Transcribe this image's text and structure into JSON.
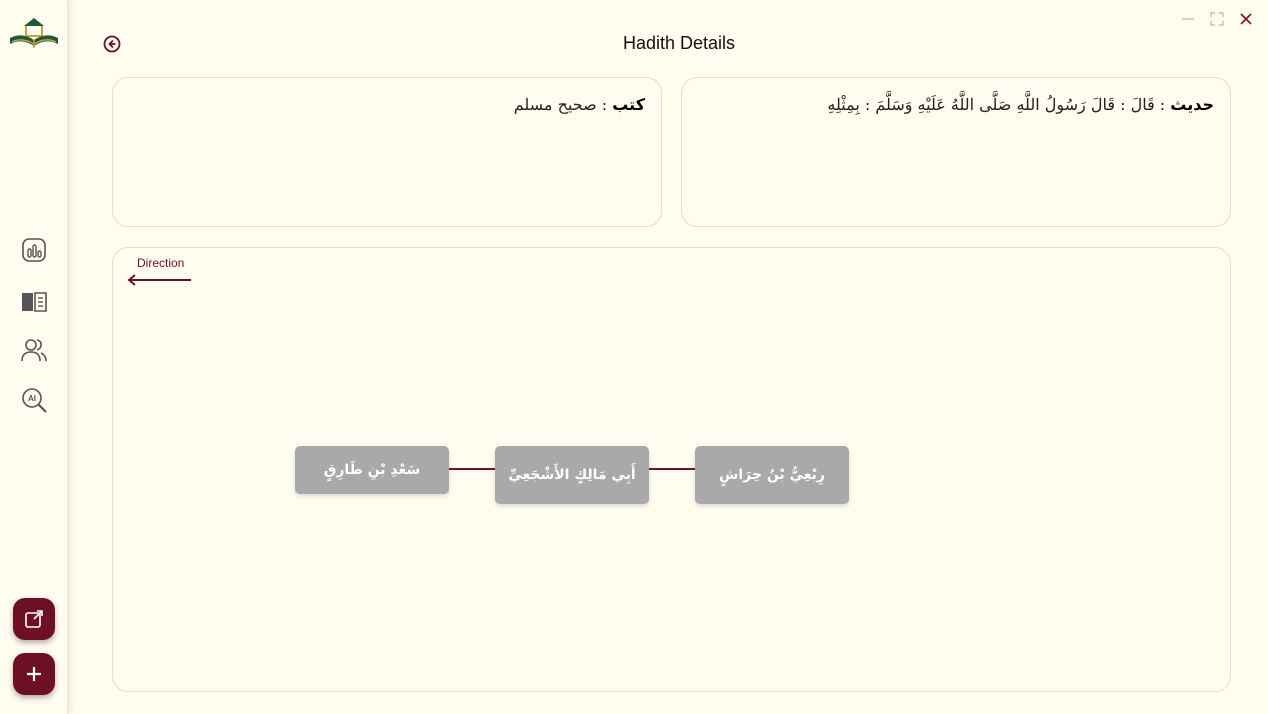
{
  "window": {
    "title": "Hadith Details",
    "controls": [
      "minimize-icon",
      "maximize-icon",
      "close-icon"
    ]
  },
  "sidebar": {
    "logo": "book-mosque-logo",
    "items": [
      {
        "icon": "chart-icon"
      },
      {
        "icon": "book-icon"
      },
      {
        "icon": "users-icon"
      },
      {
        "icon": "ai-search-icon"
      }
    ],
    "fabs": [
      {
        "icon": "external-link-icon"
      },
      {
        "icon": "plus-icon"
      }
    ]
  },
  "cards": {
    "book": {
      "label": "كتب",
      "value": "صحيح مسلم"
    },
    "hadith": {
      "label": "حديث",
      "value": "قَالَ : قَالَ رَسُولُ اللَّهِ صَلَّى اللَّهُ عَلَيْهِ وَسَلَّمَ : بِمِثْلِهِ"
    }
  },
  "graph": {
    "direction_label": "Direction",
    "nodes": [
      {
        "name": "سَعْدِ بْنِ طَارِقٍ"
      },
      {
        "name": "أَبِي مَالِكٍ الأَشْجَعِيِّ"
      },
      {
        "name": "رِبْعِيُّ بْنُ حِرَاشٍ"
      }
    ]
  },
  "colors": {
    "accent": "#6e1025",
    "background": "#fffcf0",
    "node": "#a9a9a9",
    "border": "#e6dfc7"
  }
}
